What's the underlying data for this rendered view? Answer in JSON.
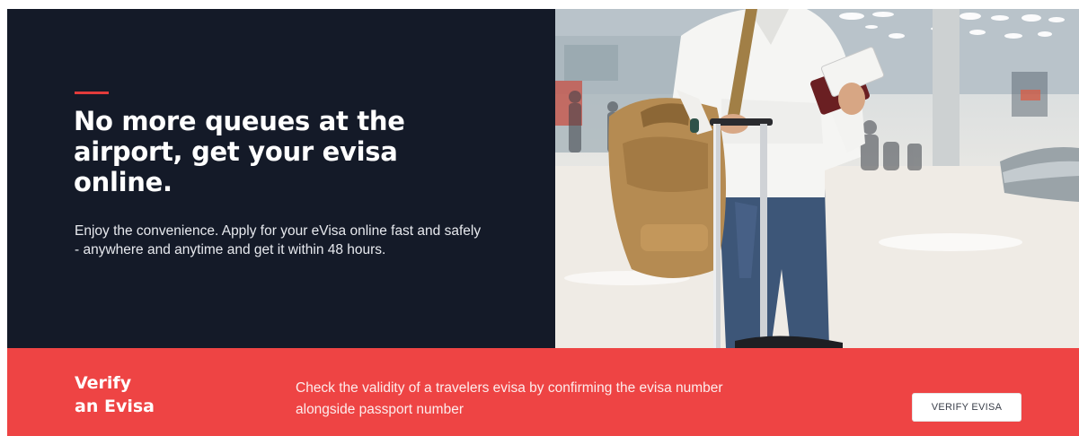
{
  "hero": {
    "title": "No more queues at the airport, get your evisa online.",
    "description": "Enjoy the convenience. Apply for your eVisa online fast and safely - anywhere and anytime and get it within 48 hours.",
    "accent_color": "#e23b3b",
    "background_color": "#141a28",
    "image_subject": "traveler-with-luggage-at-airport"
  },
  "verify": {
    "title_line1": "Verify",
    "title_line2": "an Evisa",
    "description": "Check the validity of a travelers evisa by confirming the evisa number alongside passport number",
    "button_label": "VERIFY EVISA",
    "background_color": "#ee4444"
  }
}
